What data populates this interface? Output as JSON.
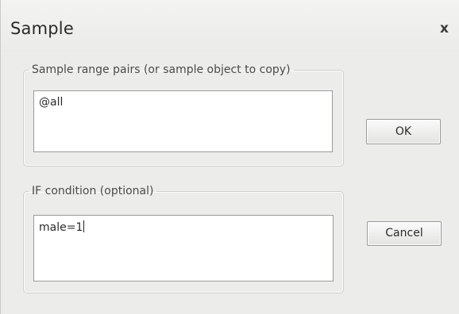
{
  "window": {
    "title": "Sample",
    "close_glyph": "x"
  },
  "sample_range": {
    "legend": "Sample range pairs (or sample object to copy)",
    "value": "@all"
  },
  "if_condition": {
    "legend": "IF condition (optional)",
    "value": "male=1"
  },
  "buttons": {
    "ok_label": "OK",
    "cancel_label": "Cancel"
  },
  "icons": {
    "close": "close-icon"
  },
  "colors": {
    "background": "#ececea",
    "textbox_bg": "#ffffff",
    "border": "#9b9b9b"
  }
}
